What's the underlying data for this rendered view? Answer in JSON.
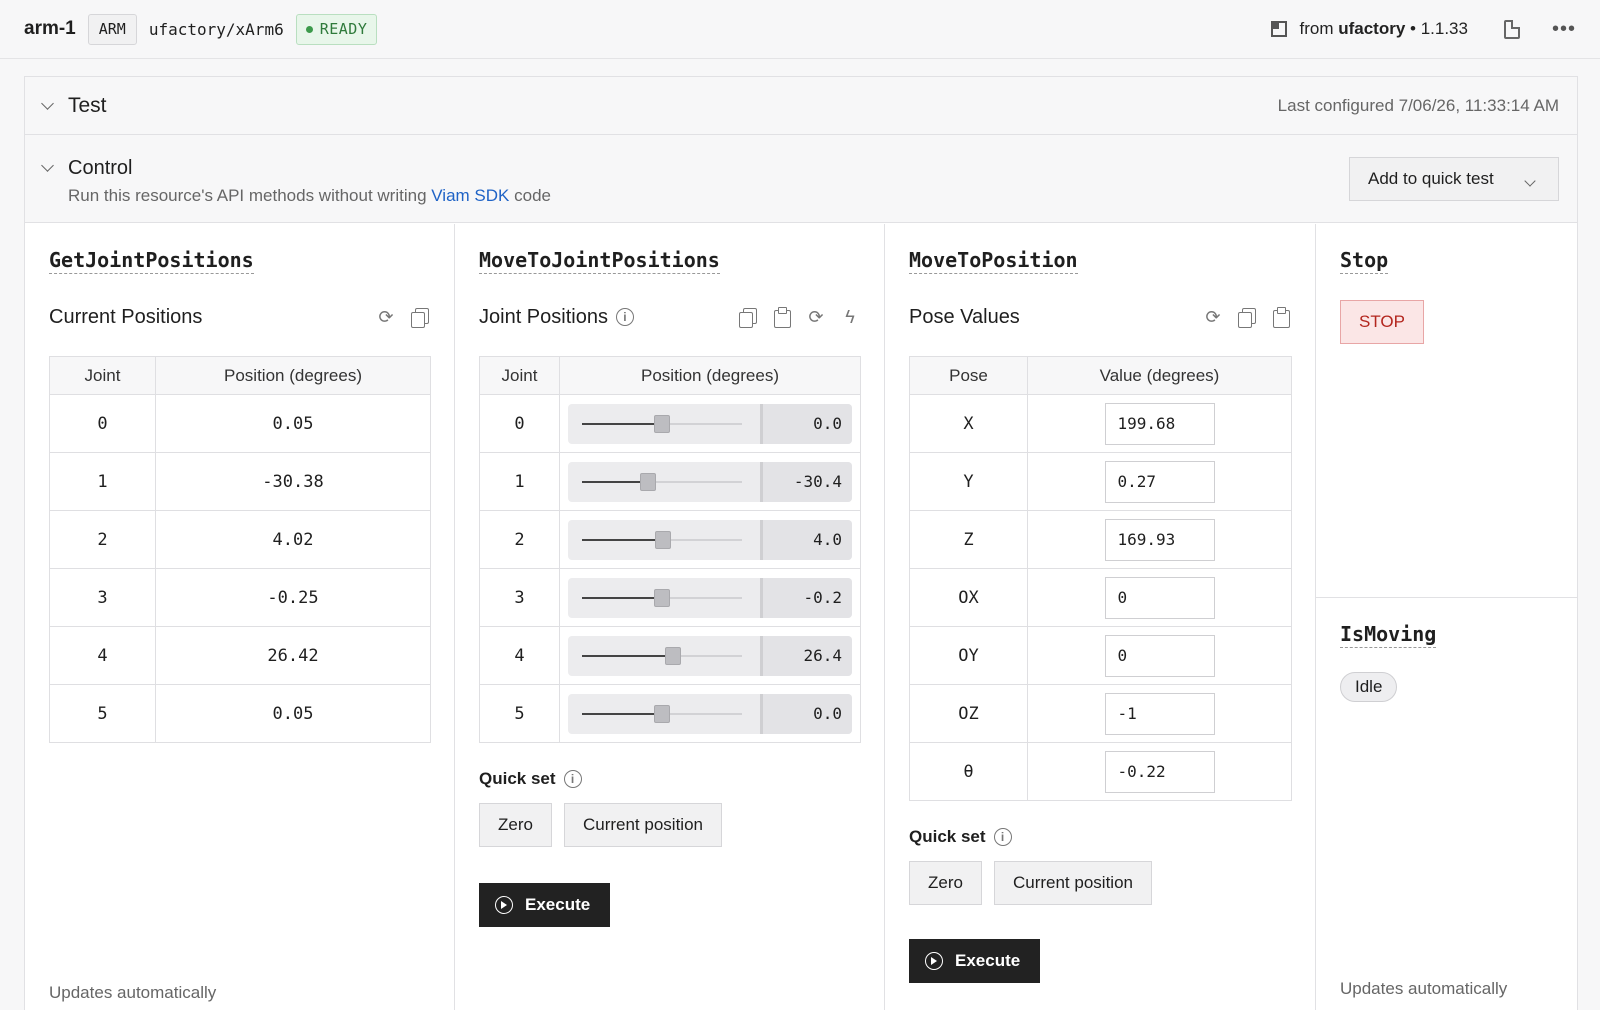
{
  "header": {
    "name": "arm-1",
    "type_chip": "ARM",
    "model": "ufactory/xArm6",
    "status": "READY",
    "from_prefix": "from",
    "from_vendor": "ufactory",
    "from_version": "• 1.1.33",
    "colors": {
      "ready_green": "#2f7a3b",
      "link_blue": "#1f63c6",
      "stop_red": "#b3261e"
    }
  },
  "test": {
    "title": "Test",
    "last_configured": "Last configured 7/06/26, 11:33:14 AM"
  },
  "control": {
    "title": "Control",
    "sub_before": "Run this resource's API methods without writing",
    "sub_link": "Viam SDK",
    "sub_after": "code",
    "add_quick_test": "Add to quick test"
  },
  "get_joint_positions": {
    "method": "GetJointPositions",
    "section": "Current Positions",
    "headers": [
      "Joint",
      "Position (degrees)"
    ],
    "rows": [
      {
        "joint": "0",
        "value": "0.05"
      },
      {
        "joint": "1",
        "value": "-30.38"
      },
      {
        "joint": "2",
        "value": "4.02"
      },
      {
        "joint": "3",
        "value": "-0.25"
      },
      {
        "joint": "4",
        "value": "26.42"
      },
      {
        "joint": "5",
        "value": "0.05"
      }
    ],
    "footer": "Updates automatically"
  },
  "move_to_joint_positions": {
    "method": "MoveToJointPositions",
    "section": "Joint Positions",
    "headers": [
      "Joint",
      "Position (degrees)"
    ],
    "rows": [
      {
        "joint": "0",
        "value": "0.0",
        "fraction": 0.5
      },
      {
        "joint": "1",
        "value": "-30.4",
        "fraction": 0.41
      },
      {
        "joint": "2",
        "value": "4.0",
        "fraction": 0.505
      },
      {
        "joint": "3",
        "value": "-0.2",
        "fraction": 0.5
      },
      {
        "joint": "4",
        "value": "26.4",
        "fraction": 0.57
      },
      {
        "joint": "5",
        "value": "0.0",
        "fraction": 0.5
      }
    ],
    "quick_set": "Quick set",
    "zero": "Zero",
    "current_position": "Current position",
    "execute": "Execute"
  },
  "move_to_position": {
    "method": "MoveToPosition",
    "section": "Pose Values",
    "headers": [
      "Pose",
      "Value (degrees)"
    ],
    "rows": [
      {
        "pose": "X",
        "value": "199.68"
      },
      {
        "pose": "Y",
        "value": "0.27"
      },
      {
        "pose": "Z",
        "value": "169.93"
      },
      {
        "pose": "OX",
        "value": "0"
      },
      {
        "pose": "OY",
        "value": "0"
      },
      {
        "pose": "OZ",
        "value": "-1"
      },
      {
        "pose": "θ",
        "value": "-0.22"
      }
    ],
    "quick_set": "Quick set",
    "zero": "Zero",
    "current_position": "Current position",
    "execute": "Execute"
  },
  "stop": {
    "method": "Stop",
    "button": "STOP"
  },
  "is_moving": {
    "method": "IsMoving",
    "state": "Idle",
    "footer": "Updates automatically"
  }
}
